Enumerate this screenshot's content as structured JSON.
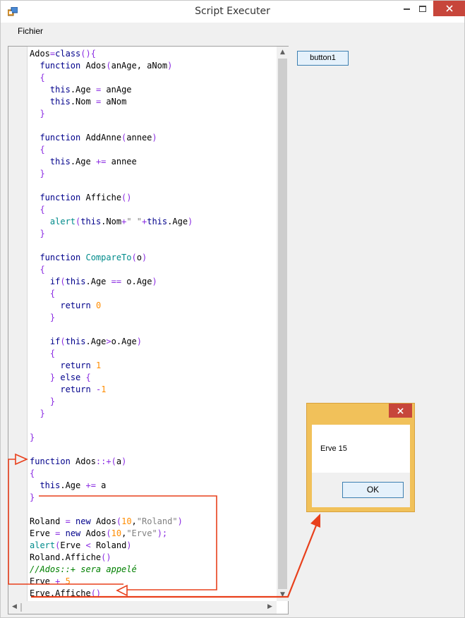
{
  "window": {
    "title": "Script Executer",
    "accent_close": "#c7463b"
  },
  "menu": {
    "file_label": "Fichier"
  },
  "toolbar": {
    "button1_label": "button1"
  },
  "code_lines": [
    [
      [
        "t",
        "Ados"
      ],
      [
        "o",
        "="
      ],
      [
        "k",
        "class"
      ],
      [
        "b",
        "(){"
      ]
    ],
    [
      [
        "t",
        "  "
      ],
      [
        "k",
        "function"
      ],
      [
        "t",
        " Ados"
      ],
      [
        "b",
        "("
      ],
      [
        "t",
        "anAge, aNom"
      ],
      [
        "b",
        ")"
      ]
    ],
    [
      [
        "t",
        "  "
      ],
      [
        "b",
        "{"
      ]
    ],
    [
      [
        "t",
        "    "
      ],
      [
        "k",
        "this"
      ],
      [
        "t",
        ".Age "
      ],
      [
        "o",
        "="
      ],
      [
        "t",
        " anAge"
      ]
    ],
    [
      [
        "t",
        "    "
      ],
      [
        "k",
        "this"
      ],
      [
        "t",
        ".Nom "
      ],
      [
        "o",
        "="
      ],
      [
        "t",
        " aNom"
      ]
    ],
    [
      [
        "t",
        "  "
      ],
      [
        "b",
        "}"
      ]
    ],
    [
      [
        "t",
        ""
      ]
    ],
    [
      [
        "t",
        "  "
      ],
      [
        "k",
        "function"
      ],
      [
        "t",
        " AddAnne"
      ],
      [
        "b",
        "("
      ],
      [
        "t",
        "annee"
      ],
      [
        "b",
        ")"
      ]
    ],
    [
      [
        "t",
        "  "
      ],
      [
        "b",
        "{"
      ]
    ],
    [
      [
        "t",
        "    "
      ],
      [
        "k",
        "this"
      ],
      [
        "t",
        ".Age "
      ],
      [
        "o",
        "+="
      ],
      [
        "t",
        " annee"
      ]
    ],
    [
      [
        "t",
        "  "
      ],
      [
        "b",
        "}"
      ]
    ],
    [
      [
        "t",
        ""
      ]
    ],
    [
      [
        "t",
        "  "
      ],
      [
        "k",
        "function"
      ],
      [
        "t",
        " Affiche"
      ],
      [
        "b",
        "()"
      ]
    ],
    [
      [
        "t",
        "  "
      ],
      [
        "b",
        "{"
      ]
    ],
    [
      [
        "t",
        "    "
      ],
      [
        "f",
        "alert"
      ],
      [
        "b",
        "("
      ],
      [
        "k",
        "this"
      ],
      [
        "t",
        ".Nom"
      ],
      [
        "o",
        "+"
      ],
      [
        "s",
        "\" \""
      ],
      [
        "o",
        "+"
      ],
      [
        "k",
        "this"
      ],
      [
        "t",
        ".Age"
      ],
      [
        "b",
        ")"
      ]
    ],
    [
      [
        "t",
        "  "
      ],
      [
        "b",
        "}"
      ]
    ],
    [
      [
        "t",
        ""
      ]
    ],
    [
      [
        "t",
        "  "
      ],
      [
        "k",
        "function"
      ],
      [
        "t",
        " "
      ],
      [
        "f",
        "CompareTo"
      ],
      [
        "b",
        "("
      ],
      [
        "t",
        "o"
      ],
      [
        "b",
        ")"
      ]
    ],
    [
      [
        "t",
        "  "
      ],
      [
        "b",
        "{"
      ]
    ],
    [
      [
        "t",
        "    "
      ],
      [
        "k",
        "if"
      ],
      [
        "b",
        "("
      ],
      [
        "k",
        "this"
      ],
      [
        "t",
        ".Age "
      ],
      [
        "o",
        "=="
      ],
      [
        "t",
        " o.Age"
      ],
      [
        "b",
        ")"
      ]
    ],
    [
      [
        "t",
        "    "
      ],
      [
        "b",
        "{"
      ]
    ],
    [
      [
        "t",
        "      "
      ],
      [
        "k",
        "return"
      ],
      [
        "t",
        " "
      ],
      [
        "n",
        "0"
      ]
    ],
    [
      [
        "t",
        "    "
      ],
      [
        "b",
        "}"
      ]
    ],
    [
      [
        "t",
        ""
      ]
    ],
    [
      [
        "t",
        "    "
      ],
      [
        "k",
        "if"
      ],
      [
        "b",
        "("
      ],
      [
        "k",
        "this"
      ],
      [
        "t",
        ".Age"
      ],
      [
        "o",
        ">"
      ],
      [
        "t",
        "o.Age"
      ],
      [
        "b",
        ")"
      ]
    ],
    [
      [
        "t",
        "    "
      ],
      [
        "b",
        "{"
      ]
    ],
    [
      [
        "t",
        "      "
      ],
      [
        "k",
        "return"
      ],
      [
        "t",
        " "
      ],
      [
        "n",
        "1"
      ]
    ],
    [
      [
        "t",
        "    "
      ],
      [
        "b",
        "}"
      ],
      [
        "t",
        " "
      ],
      [
        "k",
        "else"
      ],
      [
        "t",
        " "
      ],
      [
        "b",
        "{"
      ]
    ],
    [
      [
        "t",
        "      "
      ],
      [
        "k",
        "return"
      ],
      [
        "t",
        " "
      ],
      [
        "o",
        "-"
      ],
      [
        "n",
        "1"
      ]
    ],
    [
      [
        "t",
        "    "
      ],
      [
        "b",
        "}"
      ]
    ],
    [
      [
        "t",
        "  "
      ],
      [
        "b",
        "}"
      ]
    ],
    [
      [
        "t",
        ""
      ]
    ],
    [
      [
        "b",
        "}"
      ]
    ],
    [
      [
        "t",
        ""
      ]
    ],
    [
      [
        "k",
        "function"
      ],
      [
        "t",
        " Ados"
      ],
      [
        "o",
        "::+"
      ],
      [
        "b",
        "("
      ],
      [
        "t",
        "a"
      ],
      [
        "b",
        ")"
      ]
    ],
    [
      [
        "b",
        "{"
      ]
    ],
    [
      [
        "t",
        "  "
      ],
      [
        "k",
        "this"
      ],
      [
        "t",
        ".Age "
      ],
      [
        "o",
        "+="
      ],
      [
        "t",
        " a"
      ]
    ],
    [
      [
        "b",
        "}"
      ]
    ],
    [
      [
        "t",
        ""
      ]
    ],
    [
      [
        "t",
        "Roland "
      ],
      [
        "o",
        "="
      ],
      [
        "t",
        " "
      ],
      [
        "k",
        "new"
      ],
      [
        "t",
        " Ados"
      ],
      [
        "b",
        "("
      ],
      [
        "n",
        "10"
      ],
      [
        "t",
        ","
      ],
      [
        "s",
        "\"Roland\""
      ],
      [
        "b",
        ")"
      ]
    ],
    [
      [
        "t",
        "Erve "
      ],
      [
        "o",
        "="
      ],
      [
        "t",
        " "
      ],
      [
        "k",
        "new"
      ],
      [
        "t",
        " Ados"
      ],
      [
        "b",
        "("
      ],
      [
        "n",
        "10"
      ],
      [
        "t",
        ","
      ],
      [
        "s",
        "\"Erve\""
      ],
      [
        "b",
        ");"
      ]
    ],
    [
      [
        "f",
        "alert"
      ],
      [
        "b",
        "("
      ],
      [
        "t",
        "Erve "
      ],
      [
        "o",
        "<"
      ],
      [
        "t",
        " Roland"
      ],
      [
        "b",
        ")"
      ]
    ],
    [
      [
        "t",
        "Roland.Affiche"
      ],
      [
        "b",
        "()"
      ]
    ],
    [
      [
        "c",
        "//Ados::+ sera appelé"
      ]
    ],
    [
      [
        "t",
        "Erve "
      ],
      [
        "o",
        "+"
      ],
      [
        "t",
        " "
      ],
      [
        "n",
        "5"
      ]
    ],
    [
      [
        "t",
        "Erve.Affiche"
      ],
      [
        "b",
        "()"
      ]
    ]
  ],
  "alert_dialog": {
    "message": "Erve 15",
    "ok_label": "OK"
  },
  "annotation_color": "#e8401c"
}
